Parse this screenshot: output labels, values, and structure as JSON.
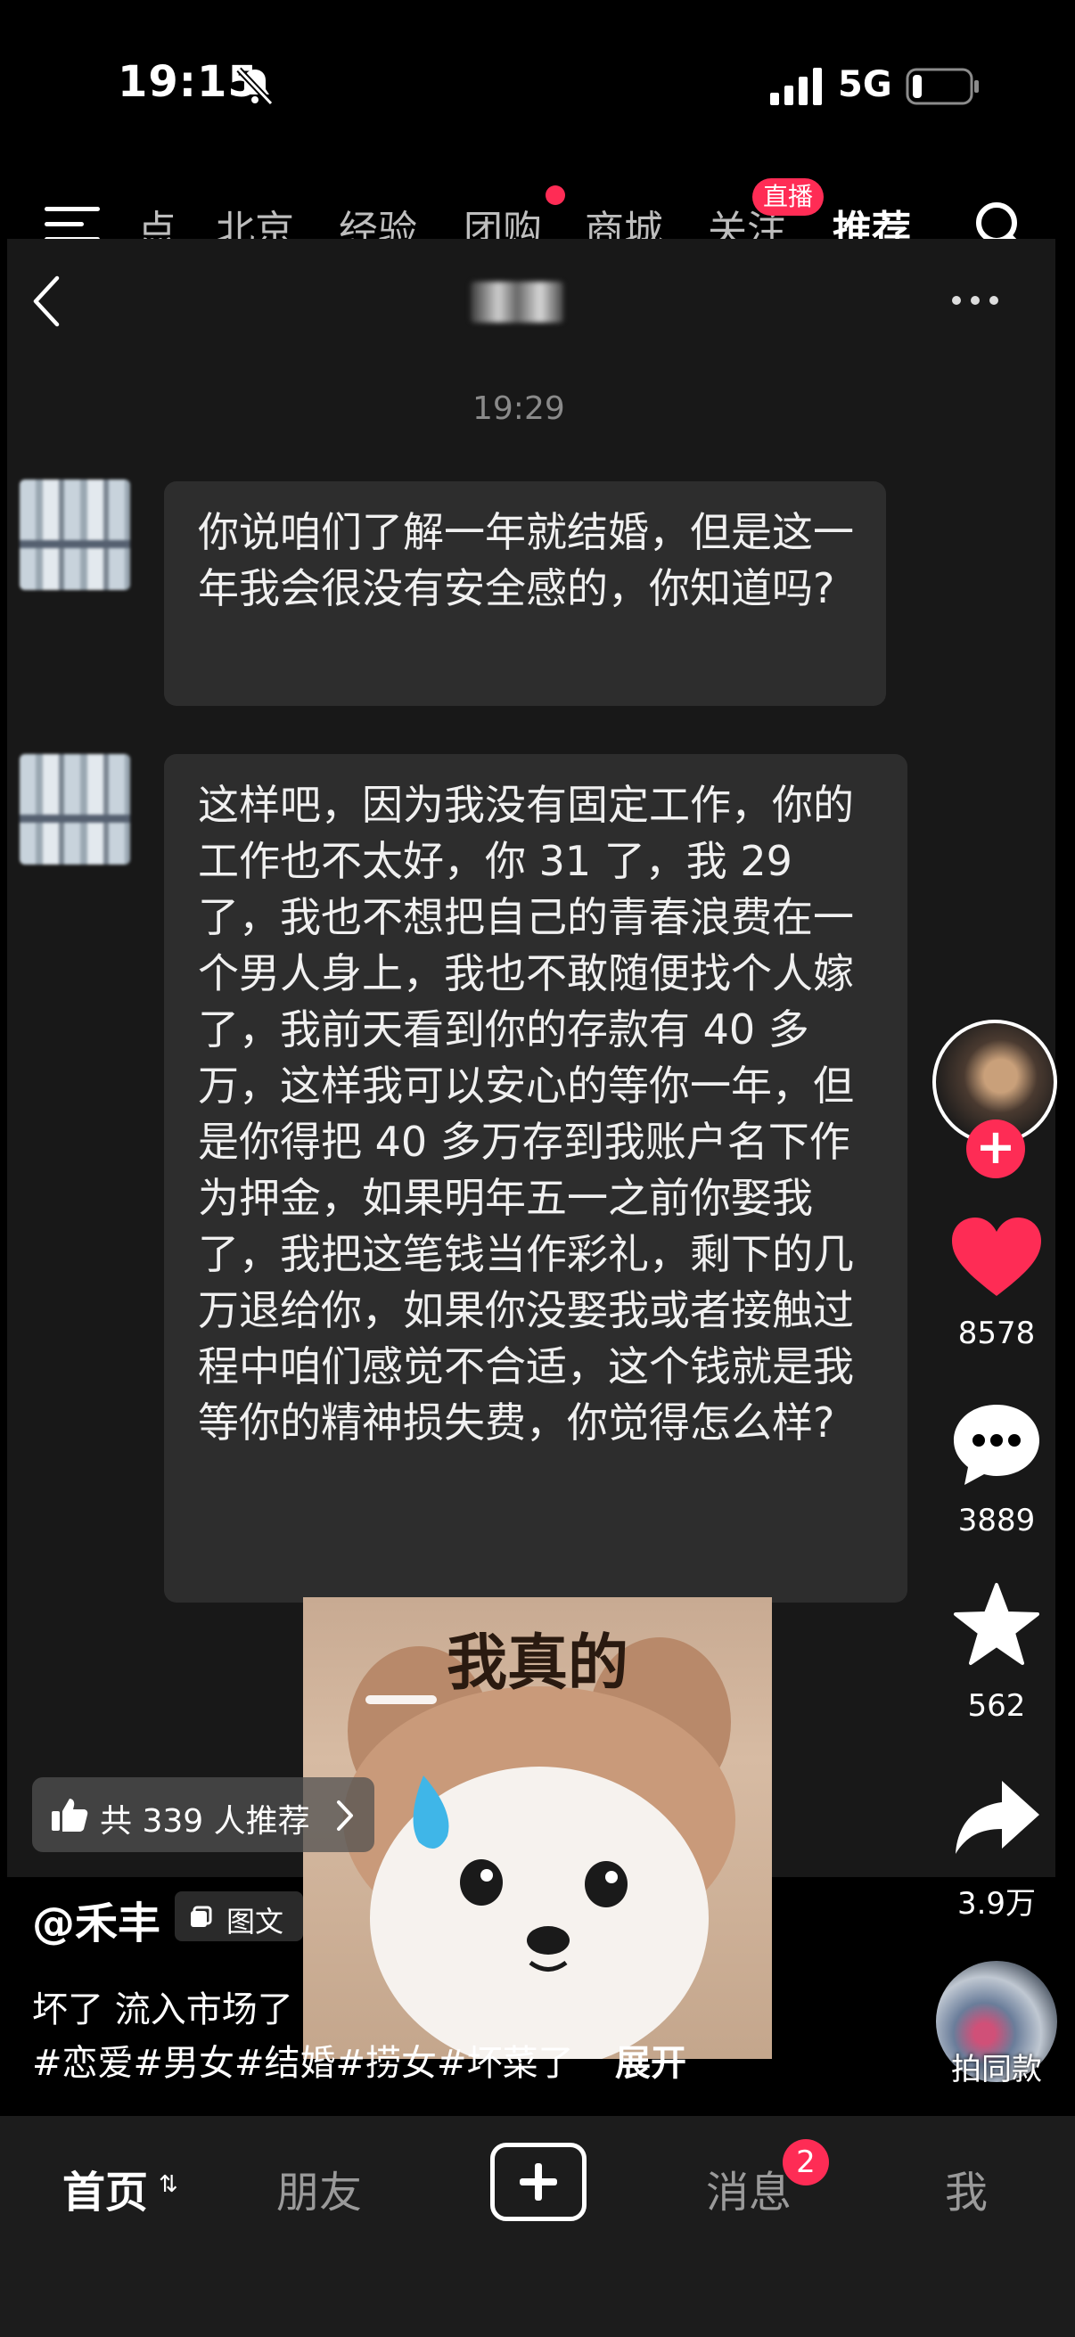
{
  "status_bar": {
    "time": "19:15",
    "network": "5G"
  },
  "top_tabs": {
    "items": [
      "点",
      "北京",
      "经验",
      "团购",
      "商城",
      "关注",
      "推荐"
    ],
    "active": "推荐",
    "live_badge": "直播"
  },
  "chat": {
    "timestamp": "19:29",
    "messages": [
      "你说咱们了解一年就结婚，但是这一年我会很没有安全感的，你知道吗?",
      "这样吧，因为我没有固定工作，你的工作也不太好，你 31 了，我 29 了，我也不想把自己的青春浪费在一个男人身上，我也不敢随便找个人嫁了，我前天看到你的存款有 40 多万，这样我可以安心的等你一年，但是你得把 40 多万存到我账户名下作为押金，如果明年五一之前你娶我了，我把这笔钱当作彩礼，剩下的几万退给你，如果你没娶我或者接触过程中咱们感觉不合适，这个钱就是我等你的精神损失费，你觉得怎么样?"
    ],
    "sticker_caption": "我真的"
  },
  "actions": {
    "like_count": "8578",
    "comment_count": "3889",
    "favorite_count": "562",
    "share_count": "3.9万",
    "same_style_label": "拍同款",
    "like_color": "#fe2c55"
  },
  "post": {
    "recommend_text": "共 339 人推荐",
    "author": "@禾丰",
    "type_label": "图文",
    "caption": "坏了 流入市场了",
    "hashtags": "#恋爱#男女#结婚#捞女#坏菜了",
    "expand_label": "展开"
  },
  "bottom_nav": {
    "home": "首页",
    "friends": "朋友",
    "messages": "消息",
    "messages_badge": "2",
    "me": "我"
  }
}
